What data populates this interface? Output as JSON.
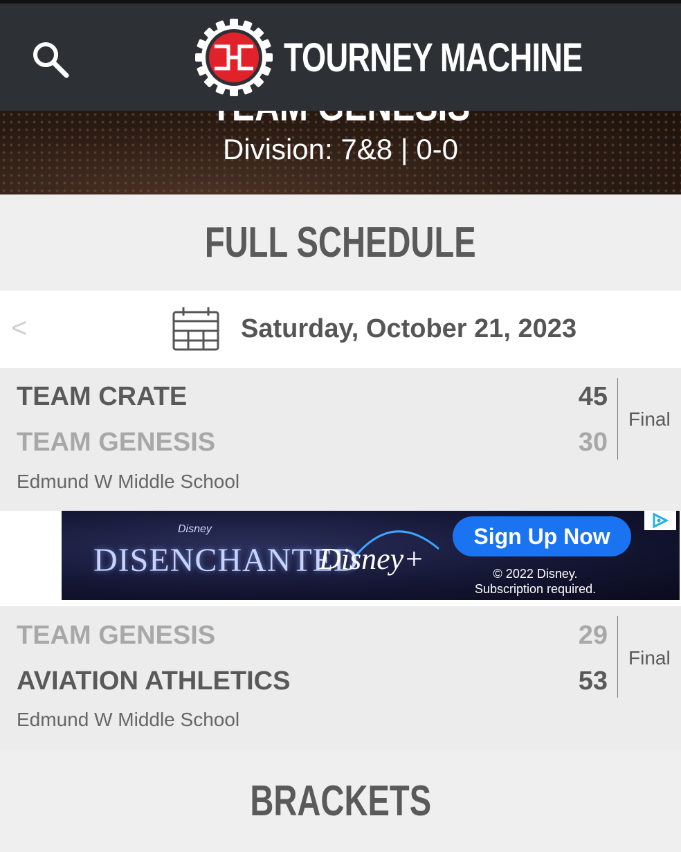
{
  "header": {
    "brand_name": "TOURNEY MACHINE",
    "search_icon": "search-icon",
    "logo_icon": "bracket-gear-logo",
    "colors": {
      "bar": "#2d3136",
      "logo_red": "#e2222a"
    }
  },
  "hero": {
    "team_name": "TEAM GENESIS",
    "division": "Division: 7&8 | 0-0"
  },
  "schedule": {
    "title": "FULL SCHEDULE",
    "prev_label": "<",
    "date": "Saturday, October 21, 2023",
    "games": [
      {
        "team1": "TEAM CRATE",
        "score1": "45",
        "team2": "TEAM GENESIS",
        "score2": "30",
        "status": "Final",
        "venue": "Edmund W Middle School"
      },
      {
        "team1": "TEAM GENESIS",
        "score1": "29",
        "team2": "AVIATION ATHLETICS",
        "score2": "53",
        "status": "Final",
        "venue": "Edmund W Middle School"
      }
    ]
  },
  "ad": {
    "brand_small": "Disney",
    "title": "DISENCHANTED",
    "service": "Disney+",
    "cta": "Sign Up Now",
    "copyright": "© 2022 Disney.",
    "disclaimer": "Subscription required.",
    "choices_icon": "ad-choices-icon",
    "cta_color": "#1a73f0"
  },
  "brackets": {
    "title": "BRACKETS"
  }
}
